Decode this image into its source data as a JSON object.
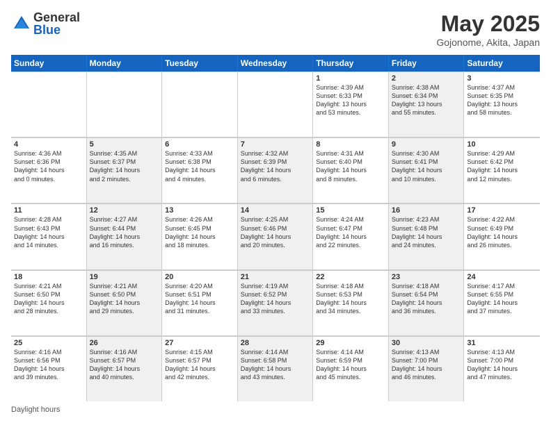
{
  "logo": {
    "general": "General",
    "blue": "Blue"
  },
  "header": {
    "month": "May 2025",
    "location": "Gojonome, Akita, Japan"
  },
  "weekdays": [
    "Sunday",
    "Monday",
    "Tuesday",
    "Wednesday",
    "Thursday",
    "Friday",
    "Saturday"
  ],
  "footer": "Daylight hours",
  "rows": [
    [
      {
        "day": "",
        "info": "",
        "shaded": false
      },
      {
        "day": "",
        "info": "",
        "shaded": false
      },
      {
        "day": "",
        "info": "",
        "shaded": false
      },
      {
        "day": "",
        "info": "",
        "shaded": false
      },
      {
        "day": "1",
        "info": "Sunrise: 4:39 AM\nSunset: 6:33 PM\nDaylight: 13 hours\nand 53 minutes.",
        "shaded": false
      },
      {
        "day": "2",
        "info": "Sunrise: 4:38 AM\nSunset: 6:34 PM\nDaylight: 13 hours\nand 55 minutes.",
        "shaded": true
      },
      {
        "day": "3",
        "info": "Sunrise: 4:37 AM\nSunset: 6:35 PM\nDaylight: 13 hours\nand 58 minutes.",
        "shaded": false
      }
    ],
    [
      {
        "day": "4",
        "info": "Sunrise: 4:36 AM\nSunset: 6:36 PM\nDaylight: 14 hours\nand 0 minutes.",
        "shaded": false
      },
      {
        "day": "5",
        "info": "Sunrise: 4:35 AM\nSunset: 6:37 PM\nDaylight: 14 hours\nand 2 minutes.",
        "shaded": true
      },
      {
        "day": "6",
        "info": "Sunrise: 4:33 AM\nSunset: 6:38 PM\nDaylight: 14 hours\nand 4 minutes.",
        "shaded": false
      },
      {
        "day": "7",
        "info": "Sunrise: 4:32 AM\nSunset: 6:39 PM\nDaylight: 14 hours\nand 6 minutes.",
        "shaded": true
      },
      {
        "day": "8",
        "info": "Sunrise: 4:31 AM\nSunset: 6:40 PM\nDaylight: 14 hours\nand 8 minutes.",
        "shaded": false
      },
      {
        "day": "9",
        "info": "Sunrise: 4:30 AM\nSunset: 6:41 PM\nDaylight: 14 hours\nand 10 minutes.",
        "shaded": true
      },
      {
        "day": "10",
        "info": "Sunrise: 4:29 AM\nSunset: 6:42 PM\nDaylight: 14 hours\nand 12 minutes.",
        "shaded": false
      }
    ],
    [
      {
        "day": "11",
        "info": "Sunrise: 4:28 AM\nSunset: 6:43 PM\nDaylight: 14 hours\nand 14 minutes.",
        "shaded": false
      },
      {
        "day": "12",
        "info": "Sunrise: 4:27 AM\nSunset: 6:44 PM\nDaylight: 14 hours\nand 16 minutes.",
        "shaded": true
      },
      {
        "day": "13",
        "info": "Sunrise: 4:26 AM\nSunset: 6:45 PM\nDaylight: 14 hours\nand 18 minutes.",
        "shaded": false
      },
      {
        "day": "14",
        "info": "Sunrise: 4:25 AM\nSunset: 6:46 PM\nDaylight: 14 hours\nand 20 minutes.",
        "shaded": true
      },
      {
        "day": "15",
        "info": "Sunrise: 4:24 AM\nSunset: 6:47 PM\nDaylight: 14 hours\nand 22 minutes.",
        "shaded": false
      },
      {
        "day": "16",
        "info": "Sunrise: 4:23 AM\nSunset: 6:48 PM\nDaylight: 14 hours\nand 24 minutes.",
        "shaded": true
      },
      {
        "day": "17",
        "info": "Sunrise: 4:22 AM\nSunset: 6:49 PM\nDaylight: 14 hours\nand 26 minutes.",
        "shaded": false
      }
    ],
    [
      {
        "day": "18",
        "info": "Sunrise: 4:21 AM\nSunset: 6:50 PM\nDaylight: 14 hours\nand 28 minutes.",
        "shaded": false
      },
      {
        "day": "19",
        "info": "Sunrise: 4:21 AM\nSunset: 6:50 PM\nDaylight: 14 hours\nand 29 minutes.",
        "shaded": true
      },
      {
        "day": "20",
        "info": "Sunrise: 4:20 AM\nSunset: 6:51 PM\nDaylight: 14 hours\nand 31 minutes.",
        "shaded": false
      },
      {
        "day": "21",
        "info": "Sunrise: 4:19 AM\nSunset: 6:52 PM\nDaylight: 14 hours\nand 33 minutes.",
        "shaded": true
      },
      {
        "day": "22",
        "info": "Sunrise: 4:18 AM\nSunset: 6:53 PM\nDaylight: 14 hours\nand 34 minutes.",
        "shaded": false
      },
      {
        "day": "23",
        "info": "Sunrise: 4:18 AM\nSunset: 6:54 PM\nDaylight: 14 hours\nand 36 minutes.",
        "shaded": true
      },
      {
        "day": "24",
        "info": "Sunrise: 4:17 AM\nSunset: 6:55 PM\nDaylight: 14 hours\nand 37 minutes.",
        "shaded": false
      }
    ],
    [
      {
        "day": "25",
        "info": "Sunrise: 4:16 AM\nSunset: 6:56 PM\nDaylight: 14 hours\nand 39 minutes.",
        "shaded": false
      },
      {
        "day": "26",
        "info": "Sunrise: 4:16 AM\nSunset: 6:57 PM\nDaylight: 14 hours\nand 40 minutes.",
        "shaded": true
      },
      {
        "day": "27",
        "info": "Sunrise: 4:15 AM\nSunset: 6:57 PM\nDaylight: 14 hours\nand 42 minutes.",
        "shaded": false
      },
      {
        "day": "28",
        "info": "Sunrise: 4:14 AM\nSunset: 6:58 PM\nDaylight: 14 hours\nand 43 minutes.",
        "shaded": true
      },
      {
        "day": "29",
        "info": "Sunrise: 4:14 AM\nSunset: 6:59 PM\nDaylight: 14 hours\nand 45 minutes.",
        "shaded": false
      },
      {
        "day": "30",
        "info": "Sunrise: 4:13 AM\nSunset: 7:00 PM\nDaylight: 14 hours\nand 46 minutes.",
        "shaded": true
      },
      {
        "day": "31",
        "info": "Sunrise: 4:13 AM\nSunset: 7:00 PM\nDaylight: 14 hours\nand 47 minutes.",
        "shaded": false
      }
    ]
  ]
}
